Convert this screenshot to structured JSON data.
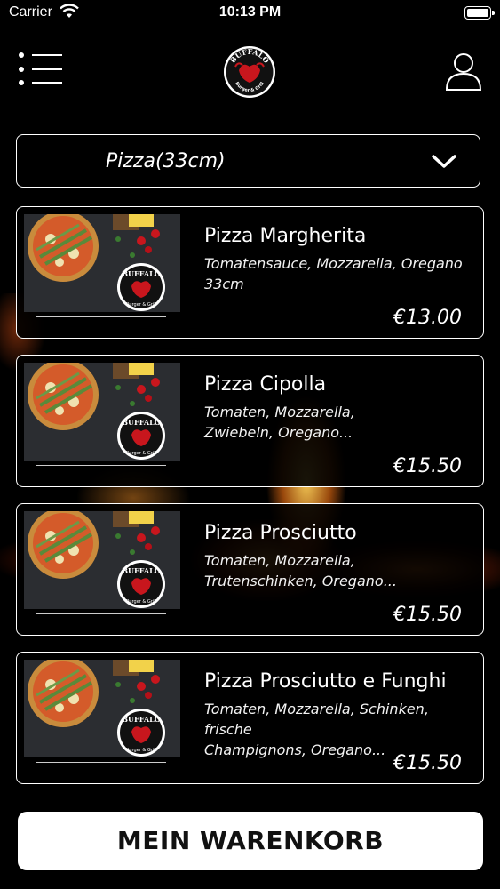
{
  "status_bar": {
    "carrier": "Carrier",
    "time": "10:13 PM"
  },
  "header": {
    "logo_text_top": "BUFFALO",
    "logo_text_bottom": "Burger & Grill"
  },
  "category": {
    "selected": "Pizza(33cm)"
  },
  "items": [
    {
      "name": "Pizza Margherita",
      "desc_line1": "Tomatensauce, Mozzarella, Oregano",
      "desc_line2": "33cm",
      "price": "€13.00"
    },
    {
      "name": "Pizza Cipolla",
      "desc_line1": "Tomaten, Mozzarella,",
      "desc_line2": "Zwiebeln, Oregano...",
      "price": "€15.50"
    },
    {
      "name": "Pizza Prosciutto",
      "desc_line1": "Tomaten, Mozzarella,",
      "desc_line2": "Trutenschinken, Oregano...",
      "price": "€15.50"
    },
    {
      "name": "Pizza Prosciutto e Funghi",
      "desc_line1": "Tomaten, Mozzarella, Schinken, frische",
      "desc_line2": "Champignons, Oregano...",
      "price": "€15.50"
    }
  ],
  "cart": {
    "label": "MEIN WARENKORB"
  },
  "colors": {
    "background": "#000000",
    "accent_red": "#c8161d",
    "button_bg": "#ffffff"
  }
}
